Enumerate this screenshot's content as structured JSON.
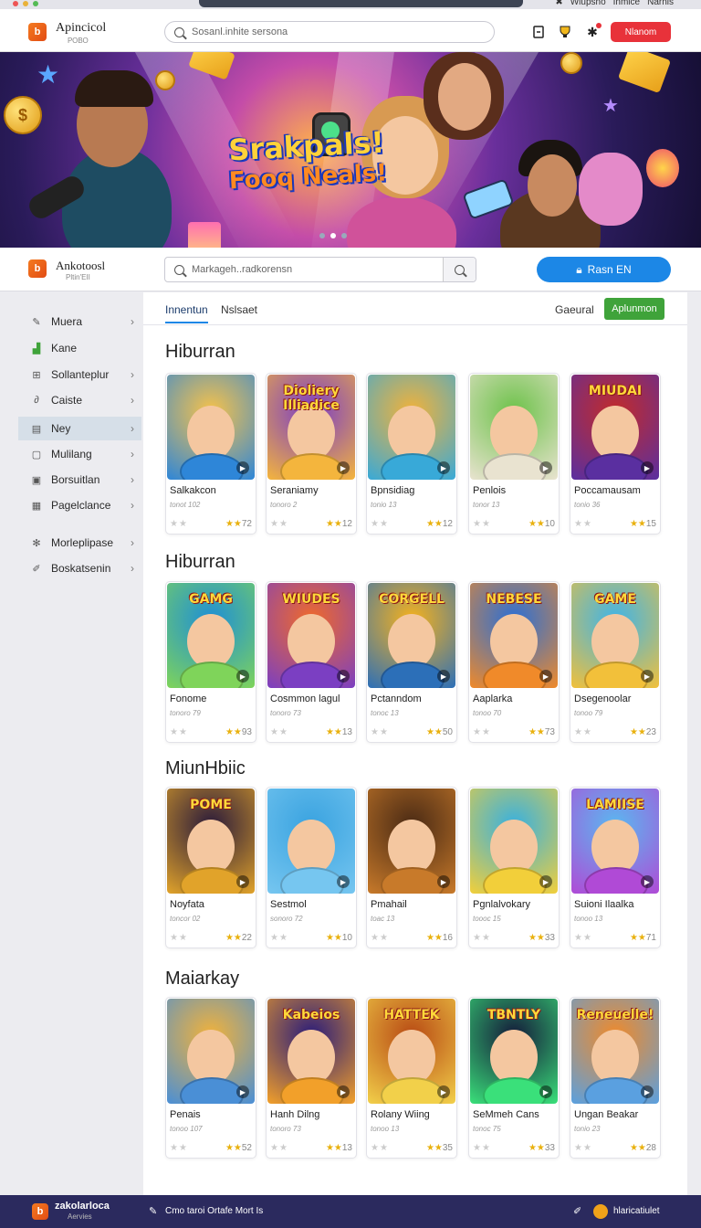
{
  "browser": {
    "tray": [
      "✖",
      "Wiupsno",
      "Inmice",
      "Narnis"
    ]
  },
  "header": {
    "logo_title": "Apincicol",
    "logo_sub": "РОВО",
    "search_placeholder": "Sosanl.inhite sersona",
    "cta_label": "Nlanom"
  },
  "hero": {
    "title_line1": "Srakpals!",
    "title_line2": "Fooq Neals!"
  },
  "header2": {
    "logo_title": "Ankotoosl",
    "logo_sub": "Pltin'EII",
    "search_placeholder": "Markageh..radkorensn",
    "cta_label": "Rasn EN"
  },
  "sidebar": {
    "items": [
      {
        "label": "Muera",
        "icon": "brush-icon"
      },
      {
        "label": "Kane",
        "icon": "chart-icon"
      },
      {
        "label": "Sollanteplur",
        "icon": "grid-icon"
      },
      {
        "label": "Caiste",
        "icon": "link-icon"
      },
      {
        "label": "Ney",
        "icon": "list-icon"
      },
      {
        "label": "Mulilang",
        "icon": "doc-icon"
      },
      {
        "label": "Borsuitlan",
        "icon": "square-icon"
      },
      {
        "label": "Pagelclance",
        "icon": "layout-icon"
      },
      {
        "label": "Morleplipase",
        "icon": "gear-icon"
      },
      {
        "label": "Boskatsenin",
        "icon": "edit-icon"
      }
    ]
  },
  "tabs": {
    "tab1": "Innentun",
    "tab2": "Nslsaet",
    "general": "Gaeural",
    "apply": "Aplunmon"
  },
  "sections": [
    {
      "title": "Hiburran",
      "cards": [
        {
          "name": "Salkakcon",
          "sub": "tonot 102",
          "rating": "72",
          "art_title": ""
        },
        {
          "name": "Seraniamy",
          "sub": "tonoro 2",
          "rating": "12",
          "art_title": "Dioliery Illiadice"
        },
        {
          "name": "Bpnsidiag",
          "sub": "tonio 13",
          "rating": "12",
          "art_title": ""
        },
        {
          "name": "Penlois",
          "sub": "tonor 13",
          "rating": "10",
          "art_title": ""
        },
        {
          "name": "Poccamausam",
          "sub": "tonio 36",
          "rating": "15",
          "art_title": "MIUDAI"
        }
      ]
    },
    {
      "title": "Hiburran",
      "cards": [
        {
          "name": "Fonome",
          "sub": "tonoro 79",
          "rating": "93",
          "art_title": "GAMG"
        },
        {
          "name": "Cosmmon lagul",
          "sub": "tonoro 73",
          "rating": "13",
          "art_title": "WIUDES"
        },
        {
          "name": "Pctanndom",
          "sub": "tonoc 13",
          "rating": "50",
          "art_title": "CORGELL"
        },
        {
          "name": "Aaplarka",
          "sub": "tonoo 70",
          "rating": "73",
          "art_title": "NEBESE"
        },
        {
          "name": "Dsegenoolar",
          "sub": "tonoo 79",
          "rating": "23",
          "art_title": "GAME"
        }
      ]
    },
    {
      "title": "MiunHbiic",
      "cards": [
        {
          "name": "Noyfata",
          "sub": "toncor 02",
          "rating": "22",
          "art_title": "POME"
        },
        {
          "name": "Sestmol",
          "sub": "sonoro 72",
          "rating": "10",
          "art_title": ""
        },
        {
          "name": "Pmahail",
          "sub": "toac 13",
          "rating": "16",
          "art_title": ""
        },
        {
          "name": "Pgnlalvokary",
          "sub": "toooc 15",
          "rating": "33",
          "art_title": ""
        },
        {
          "name": "Suioni Ilaalka",
          "sub": "tonoo 13",
          "rating": "71",
          "art_title": "LAMIISE"
        }
      ]
    },
    {
      "title": "Maiarkay",
      "cards": [
        {
          "name": "Penais",
          "sub": "tonoo 107",
          "rating": "52",
          "art_title": ""
        },
        {
          "name": "Hanh Dilng",
          "sub": "tonoro 73",
          "rating": "13",
          "art_title": "Kabeios"
        },
        {
          "name": "Rolany Wiing",
          "sub": "tonoo 13",
          "rating": "35",
          "art_title": "HATTEK"
        },
        {
          "name": "SeMmeh Cans",
          "sub": "tonoc 75",
          "rating": "33",
          "art_title": "TBNTLY"
        },
        {
          "name": "Ungan Beakar",
          "sub": "tonio 23",
          "rating": "28",
          "art_title": "Reneuelle!"
        }
      ]
    }
  ],
  "footer": {
    "logo_title": "zakolarloca",
    "logo_sub": "Aervies",
    "mid": "Cmo taroi Ortafe Mort Is",
    "right": "hlaricatiulet"
  },
  "colors": {
    "accent_red": "#e8323a",
    "accent_blue": "#1c87e6",
    "accent_green": "#3fa33a",
    "footer_bg": "#2b2a5e"
  }
}
